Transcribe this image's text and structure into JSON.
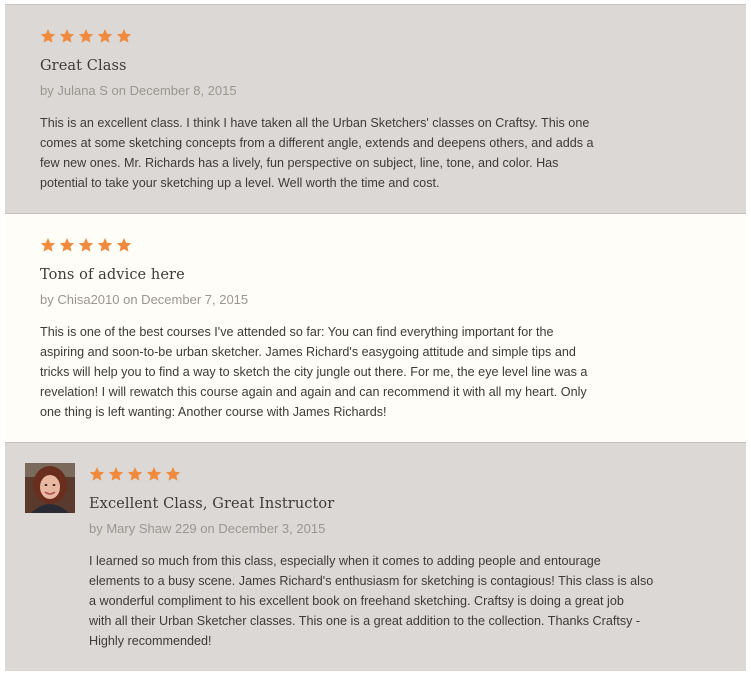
{
  "colors": {
    "star": "#f08a3c",
    "gray_bg": "#dcd8d5",
    "white_bg": "#fefdf8",
    "text": "#3e3a37",
    "muted": "#9a958f"
  },
  "reviews": [
    {
      "rating": 5,
      "title": "Great Class",
      "byline": "by Julana S on December 8, 2015",
      "body": "This is an excellent class. I think I have taken all the Urban Sketchers' classes on Craftsy. This one\ncomes at some sketching concepts from a different angle, extends and deepens others, and adds a\nfew new ones. Mr. Richards has a lively, fun perspective on subject, line, tone, and color. Has\npotential to take your sketching up a level. Well worth the time and cost."
    },
    {
      "rating": 5,
      "title": "Tons of advice here",
      "byline": "by Chisa2010 on December 7, 2015",
      "body": "This is one of the best courses I've attended so far: You can find everything important for the\naspiring and soon-to-be urban sketcher. James Richard's easygoing attitude and simple tips and\ntricks will help you to find a way to sketch the city jungle out there. For me, the eye level line was a\nrevelation! I will rewatch this course again and again and can recommend it with all my heart. Only\none thing is left wanting: Another course with James Richards!"
    },
    {
      "rating": 5,
      "avatar": "user-photo",
      "title": "Excellent Class, Great Instructor",
      "byline": "by Mary Shaw 229 on December 3, 2015",
      "body": "I learned so much from this class, especially when it comes to adding people and entourage\nelements to a busy scene. James Richard's enthusiasm for sketching is contagious! This class is also\na wonderful compliment to his excellent book on freehand sketching. Craftsy is doing a great job\nwith all their Urban Sketcher classes. This one is a great addition to the collection. Thanks Craftsy -\nHighly recommended!"
    }
  ]
}
